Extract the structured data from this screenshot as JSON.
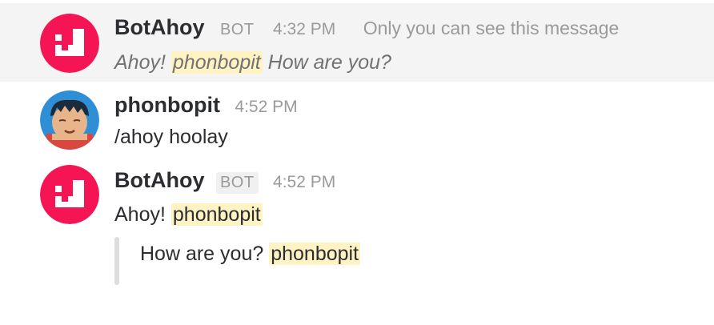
{
  "colors": {
    "bot_avatar_bg": "#f51554",
    "mention_highlight": "#fff3c4",
    "ephemeral_bg": "#f4f4f4",
    "meta_text": "#9a9a9a"
  },
  "messages": [
    {
      "username": "BotAhoy",
      "badge": "BOT",
      "time": "4:32 PM",
      "note": "Only you can see this message",
      "text_before": "Ahoy!",
      "mention": "phonbopit",
      "text_after": "How are you?",
      "avatar_icon": "botahoy-logo-icon"
    },
    {
      "username": "phonbopit",
      "time": "4:52 PM",
      "text": "/ahoy hoolay",
      "avatar_icon": "user-cartoon-face-icon"
    },
    {
      "username": "BotAhoy",
      "badge": "BOT",
      "time": "4:52 PM",
      "text_before": "Ahoy!",
      "mention": "phonbopit",
      "avatar_icon": "botahoy-logo-icon",
      "attachment": {
        "text": "How are you?",
        "mention": "phonbopit"
      }
    }
  ]
}
